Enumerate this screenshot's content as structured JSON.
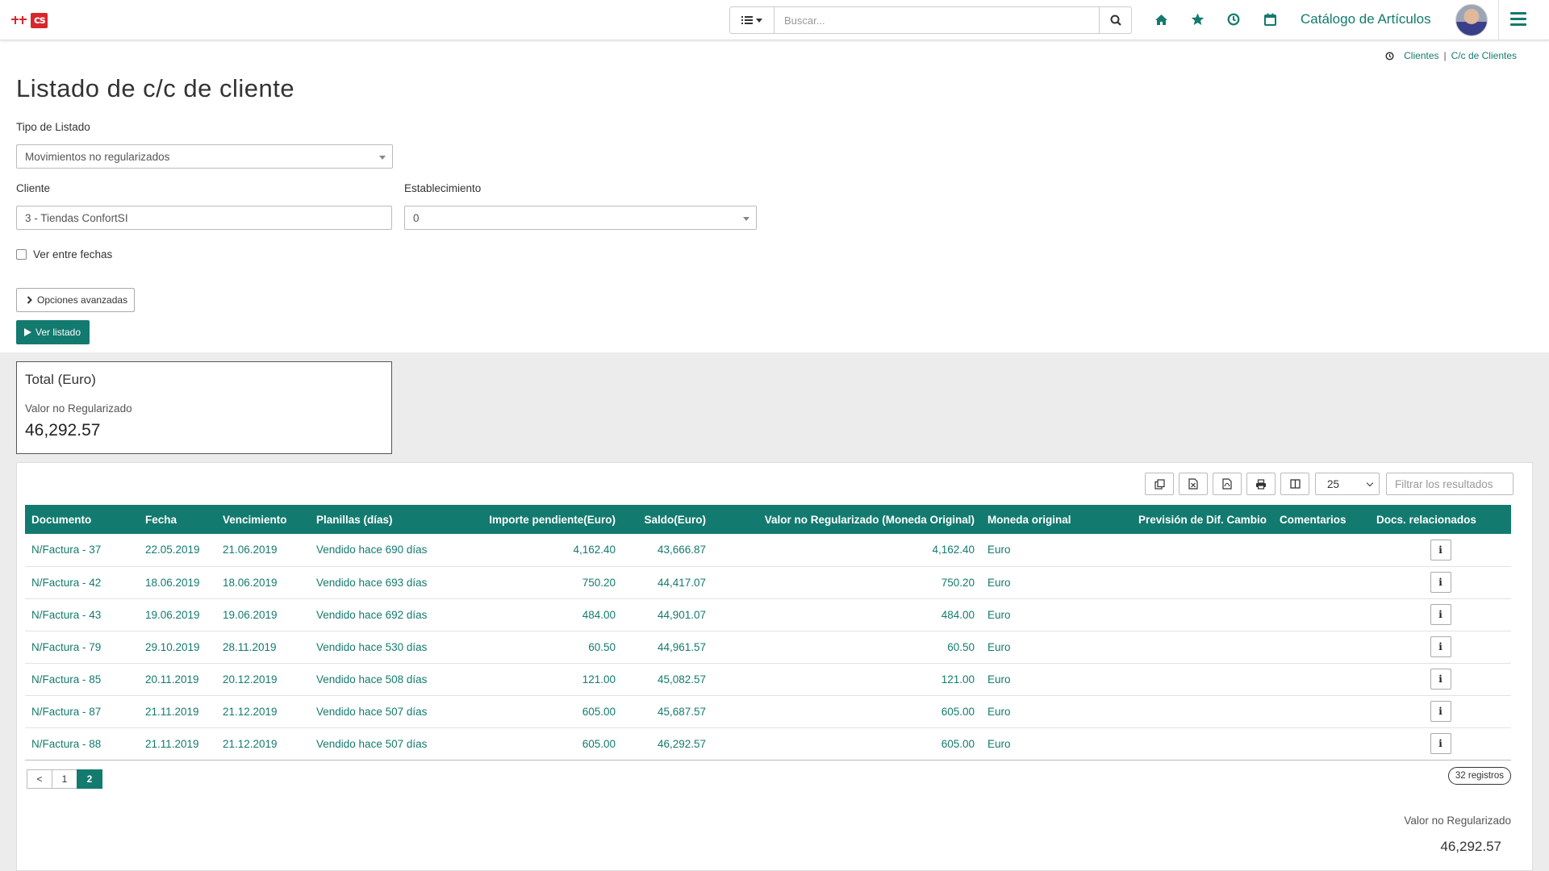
{
  "topbar": {
    "logo_text": "cs",
    "search_placeholder": "Buscar...",
    "catalog_label": "Catálogo de Artículos",
    "icons": [
      "home-icon",
      "star-icon",
      "clock-icon",
      "calendar-icon"
    ],
    "accent": "#137a6f"
  },
  "breadcrumb": {
    "items": [
      "Clientes",
      "C/c de Clientes"
    ],
    "separator": "|"
  },
  "page": {
    "title": "Listado de c/c de cliente"
  },
  "form": {
    "tipo_label": "Tipo de Listado",
    "tipo_value": "Movimientos no regularizados",
    "cliente_label": "Cliente",
    "cliente_value": "3 - Tiendas ConfortSI",
    "establecimiento_label": "Establecimiento",
    "establecimiento_value": "0",
    "fechas_label": "Ver entre fechas",
    "fechas_checked": false,
    "advanced_label": "Opciones avanzadas",
    "ver_listado_label": "Ver listado"
  },
  "total": {
    "title": "Total (Euro)",
    "sub_label": "Valor no Regularizado",
    "value": "46,292.57"
  },
  "table": {
    "page_size": "25",
    "filter_placeholder": "Filtrar los resultados",
    "columns": [
      "Documento",
      "Fecha",
      "Vencimiento",
      "Planillas (días)",
      "Importe pendiente(Euro)",
      "Saldo(Euro)",
      "Valor no Regularizado (Moneda Original)",
      "Moneda original",
      "Previsión de Dif. Cambio",
      "Comentarios",
      "Docs. relacionados"
    ],
    "rows": [
      {
        "doc": "N/Factura - 37",
        "fecha": "22.05.2019",
        "venc": "21.06.2019",
        "planillas": "Vendido hace 690 días",
        "importe": "4,162.40",
        "saldo": "43,666.87",
        "valor": "4,162.40",
        "moneda": "Euro",
        "prevision": "",
        "comentarios": "",
        "docs": "i"
      },
      {
        "doc": "N/Factura - 42",
        "fecha": "18.06.2019",
        "venc": "18.06.2019",
        "planillas": "Vendido hace 693 días",
        "importe": "750.20",
        "saldo": "44,417.07",
        "valor": "750.20",
        "moneda": "Euro",
        "prevision": "",
        "comentarios": "",
        "docs": "i"
      },
      {
        "doc": "N/Factura - 43",
        "fecha": "19.06.2019",
        "venc": "19.06.2019",
        "planillas": "Vendido hace 692 días",
        "importe": "484.00",
        "saldo": "44,901.07",
        "valor": "484.00",
        "moneda": "Euro",
        "prevision": "",
        "comentarios": "",
        "docs": "i"
      },
      {
        "doc": "N/Factura - 79",
        "fecha": "29.10.2019",
        "venc": "28.11.2019",
        "planillas": "Vendido hace 530 días",
        "importe": "60.50",
        "saldo": "44,961.57",
        "valor": "60.50",
        "moneda": "Euro",
        "prevision": "",
        "comentarios": "",
        "docs": "i"
      },
      {
        "doc": "N/Factura - 85",
        "fecha": "20.11.2019",
        "venc": "20.12.2019",
        "planillas": "Vendido hace 508 días",
        "importe": "121.00",
        "saldo": "45,082.57",
        "valor": "121.00",
        "moneda": "Euro",
        "prevision": "",
        "comentarios": "",
        "docs": "i"
      },
      {
        "doc": "N/Factura - 87",
        "fecha": "21.11.2019",
        "venc": "21.12.2019",
        "planillas": "Vendido hace 507 días",
        "importe": "605.00",
        "saldo": "45,687.57",
        "valor": "605.00",
        "moneda": "Euro",
        "prevision": "",
        "comentarios": "",
        "docs": "i"
      },
      {
        "doc": "N/Factura - 88",
        "fecha": "21.11.2019",
        "venc": "21.12.2019",
        "planillas": "Vendido hace 507 días",
        "importe": "605.00",
        "saldo": "46,292.57",
        "valor": "605.00",
        "moneda": "Euro",
        "prevision": "",
        "comentarios": "",
        "docs": "i"
      }
    ],
    "pager": {
      "prev": "<",
      "pages": [
        "1",
        "2"
      ],
      "current": "2"
    },
    "records": "32 registros"
  },
  "summary": {
    "label": "Valor no Regularizado",
    "value": "46,292.57"
  }
}
